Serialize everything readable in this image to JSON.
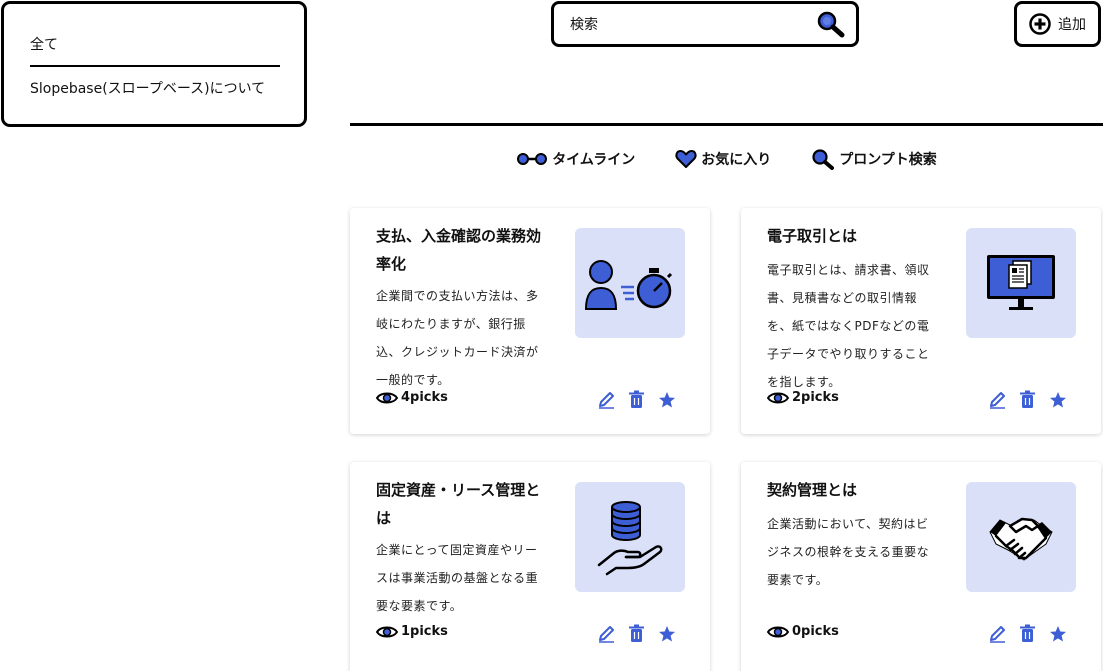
{
  "categories": {
    "items": [
      {
        "label": "全て"
      },
      {
        "label": "Slopebase(スロープベース)について"
      }
    ]
  },
  "search": {
    "placeholder": "検索",
    "value": ""
  },
  "add_button": {
    "label": "追加"
  },
  "tabs": [
    {
      "label": "タイムライン",
      "icon": "timeline-icon"
    },
    {
      "label": "お気に入り",
      "icon": "heart-icon"
    },
    {
      "label": "プロンプト検索",
      "icon": "search-icon"
    }
  ],
  "colors": {
    "accent": "#3d5ed4",
    "thumb_bg": "#dae0f8",
    "border": "#000000"
  },
  "cards": [
    {
      "title": "支払、入金確認の業務効率化",
      "description": "企業間での支払い方法は、多岐にわたりますが、銀行振込、クレジットカード決済が一般的です。",
      "picks": "4picks",
      "thumbnail_icon": "person-stopwatch-icon"
    },
    {
      "title": "電子取引とは",
      "description": "電子取引とは、請求書、領収書、見積書などの取引情報を、紙ではなくPDFなどの電子データでやり取りすることを指します。",
      "picks": "2picks",
      "thumbnail_icon": "monitor-document-icon"
    },
    {
      "title": "固定資産・リース管理とは",
      "description": "企業にとって固定資産やリースは事業活動の基盤となる重要な要素です。",
      "picks": "1picks",
      "thumbnail_icon": "hand-coins-icon"
    },
    {
      "title": "契約管理とは",
      "description": "企業活動において、契約はビジネスの根幹を支える重要な要素です。",
      "picks": "0picks",
      "thumbnail_icon": "handshake-icon"
    }
  ]
}
